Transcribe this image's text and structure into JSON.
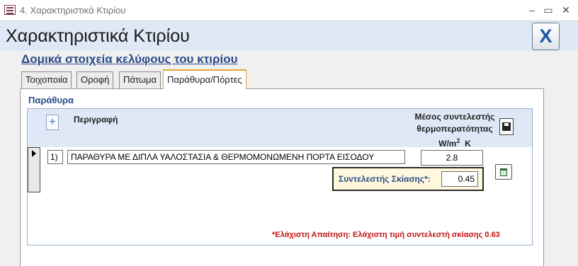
{
  "window": {
    "title": "4. Χαρακτηριστικά Κτιρίου",
    "minimize_glyph": "–",
    "maximize_glyph": "▭",
    "close_glyph": "✕"
  },
  "header": {
    "title": "Χαρακτηριστικά Κτιρίου",
    "close_label": "X"
  },
  "subheading": "Δομικά στοιχεία κελύφους του κτιρίου",
  "tabs": [
    {
      "label": "Τοιχοποιία",
      "active": false
    },
    {
      "label": "Οροφή",
      "active": false
    },
    {
      "label": "Πάτωμα",
      "active": false
    },
    {
      "label": "Παράθυρα/Πόρτες",
      "active": true
    }
  ],
  "section": {
    "label": "Παράθυρα"
  },
  "table": {
    "add_label": "+",
    "columns": {
      "description": "Περιγραφή",
      "u_line1": "Μέσος συντελεστής",
      "u_line2": "θερμοπερατότητας",
      "u_unit_prefix": "W/m",
      "u_unit_sup": "2",
      "u_unit_suffix": "K"
    },
    "rows": [
      {
        "index": "1)",
        "description": "ΠΑΡΑΘΥΡΑ ΜΕ ΔΙΠΛΑ ΥΑΛΟΣΤΑΣΙΑ & ΘΕΡΜΟΜΟΝΩΜΕΝΗ ΠΟΡΤΑ ΕΙΣΟΔΟΥ",
        "u_value": "2.8",
        "shading_label": "Συντελεστής Σκίασης*:",
        "shading_value": "0.45"
      }
    ]
  },
  "note": "*Ελάχιστη Απαίτηση: Ελάχιστη τιμή συντελεστή σκίασης  0.63",
  "icons": {
    "app": "form-icon",
    "add": "plus-icon",
    "save": "floppy-disk-icon",
    "delete": "recycle-bin-icon",
    "record": "record-pointer-icon"
  },
  "colors": {
    "header_bg": "#dfe8f6",
    "heading_blue": "#2b4c8a",
    "note_red": "#c21414",
    "shading_bg": "#fff8dc",
    "close_x": "#1f56a8"
  }
}
